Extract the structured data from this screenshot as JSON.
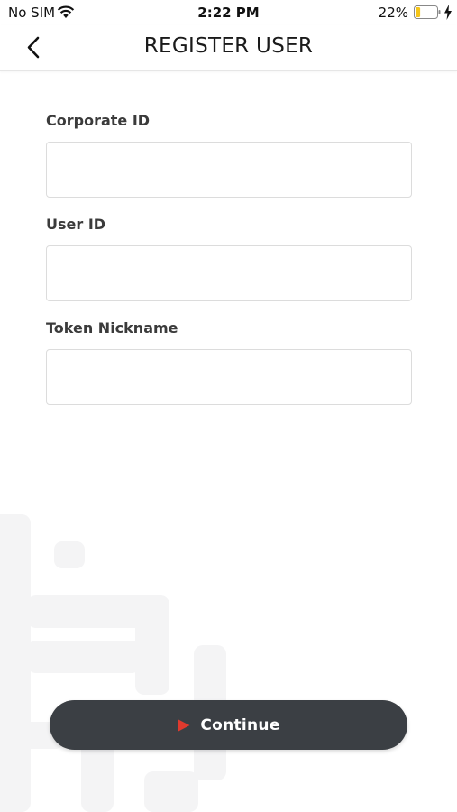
{
  "status_bar": {
    "carrier": "No SIM",
    "time": "2:22 PM",
    "battery_percent": "22%",
    "battery_level": 0.22,
    "battery_color": "#f5c518",
    "icons": [
      "wifi-icon",
      "battery-icon",
      "charging-bolt-icon"
    ]
  },
  "header": {
    "title": "REGISTER USER",
    "back_icon": "chevron-left-icon"
  },
  "form": {
    "fields": [
      {
        "label": "Corporate ID",
        "value": "",
        "placeholder": ""
      },
      {
        "label": "User ID",
        "value": "",
        "placeholder": ""
      },
      {
        "label": "Token Nickname",
        "value": "",
        "placeholder": ""
      }
    ]
  },
  "actions": {
    "continue_label": "Continue",
    "continue_icon": "play-triangle-icon",
    "button_color": "#3b3f44",
    "icon_color": "#e03a2e"
  }
}
